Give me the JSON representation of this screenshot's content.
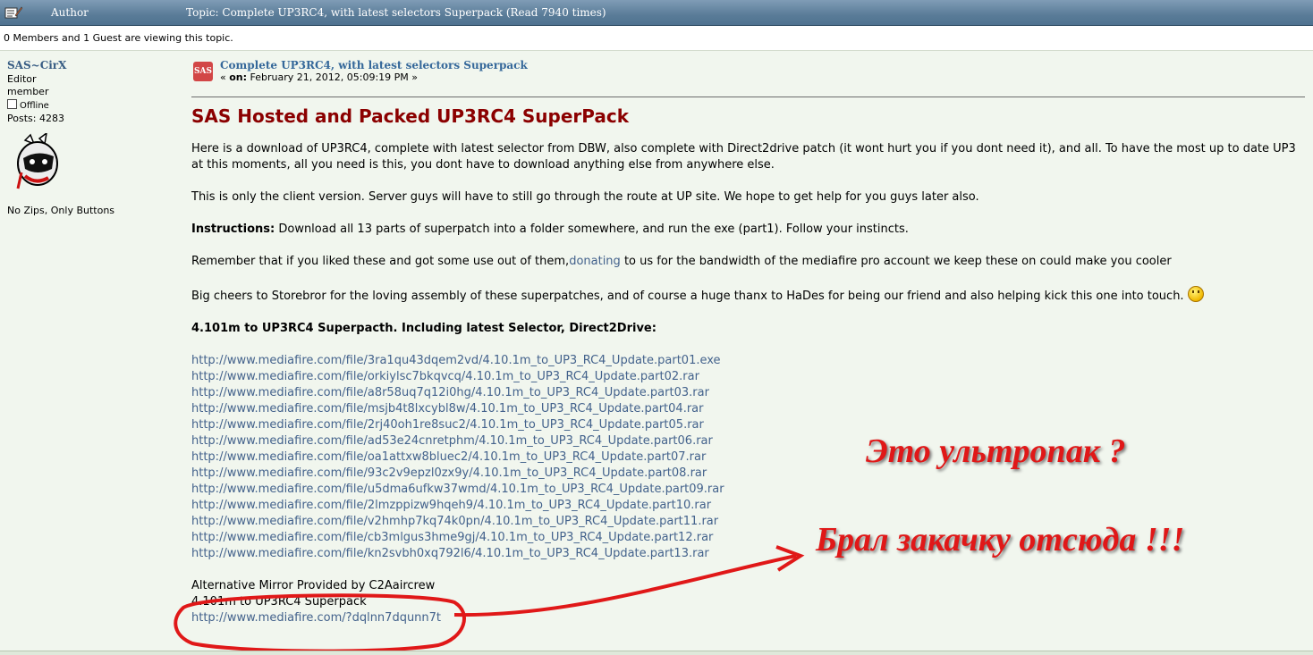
{
  "header": {
    "author_label": "Author",
    "topic_title": "Topic: Complete UP3RC4, with latest selectors Superpack  (Read 7940 times)"
  },
  "viewers_text": "0 Members and 1 Guest are viewing this topic.",
  "poster": {
    "name": "SAS~CirX",
    "title": "Editor",
    "group": "member",
    "status": "Offline",
    "posts": "Posts: 4283",
    "signature": "No Zips, Only Buttons"
  },
  "post": {
    "icon_text": "SAS",
    "subject": "Complete UP3RC4, with latest selectors Superpack",
    "on_prefix": "« ",
    "on_label": "on:",
    "date": " February 21, 2012, 05:09:19 PM »",
    "heading": "SAS Hosted and Packed UP3RC4 SuperPack",
    "para1": "Here is a download of UP3RC4, complete with latest selector from DBW, also complete with Direct2drive patch (it wont hurt you if you dont need it), and all. To have the most up to date UP3 at this moments, all you need is this, you dont have to download anything else from anywhere else.",
    "para2": "This is only the client version. Server guys will have to still go through the route at UP site. We hope to get help for you guys later also.",
    "instructions_label": "Instructions:",
    "instructions_text": " Download all 13 parts of superpatch into a folder somewhere, and run the exe (part1). Follow your instincts.",
    "remember_before": "Remember that if you liked these and got some use out of them,",
    "donating_link": "donating",
    "remember_after": " to us for the bandwidth of the mediafire pro account we keep these on could make you cooler",
    "cheers": "Big cheers to Storebror for the loving assembly of these superpatches, and of course a huge thanx to HaDes for being our friend and also helping kick this one into touch.",
    "superpatch_heading": "4.101m to UP3RC4 Superpacth. Including latest Selector, Direct2Drive:",
    "links": [
      "http://www.mediafire.com/file/3ra1qu43dqem2vd/4.10.1m_to_UP3_RC4_Update.part01.exe",
      "http://www.mediafire.com/file/orkiylsc7bkqvcq/4.10.1m_to_UP3_RC4_Update.part02.rar",
      "http://www.mediafire.com/file/a8r58uq7q12i0hg/4.10.1m_to_UP3_RC4_Update.part03.rar",
      "http://www.mediafire.com/file/msjb4t8lxcybl8w/4.10.1m_to_UP3_RC4_Update.part04.rar",
      "http://www.mediafire.com/file/2rj40oh1re8suc2/4.10.1m_to_UP3_RC4_Update.part05.rar",
      "http://www.mediafire.com/file/ad53e24cnretphm/4.10.1m_to_UP3_RC4_Update.part06.rar",
      "http://www.mediafire.com/file/oa1attxw8bluec2/4.10.1m_to_UP3_RC4_Update.part07.rar",
      "http://www.mediafire.com/file/93c2v9epzl0zx9y/4.10.1m_to_UP3_RC4_Update.part08.rar",
      "http://www.mediafire.com/file/u5dma6ufkw37wmd/4.10.1m_to_UP3_RC4_Update.part09.rar",
      "http://www.mediafire.com/file/2lmzppizw9hqeh9/4.10.1m_to_UP3_RC4_Update.part10.rar",
      "http://www.mediafire.com/file/v2hmhp7kq74k0pn/4.10.1m_to_UP3_RC4_Update.part11.rar",
      "http://www.mediafire.com/file/cb3mlgus3hme9gj/4.10.1m_to_UP3_RC4_Update.part12.rar",
      "http://www.mediafire.com/file/kn2svbh0xq792l6/4.10.1m_to_UP3_RC4_Update.part13.rar"
    ],
    "mirror_label": "Alternative Mirror Provided by C2Aaircrew",
    "mirror_title": "4.101m to UP3RC4 Superpack",
    "mirror_link": "http://www.mediafire.com/?dqlnn7dqunn7t"
  },
  "annotations": {
    "question": "Это ультропак ?",
    "took_from": "Брал закачку отсюда !!!",
    "color": "#e01818"
  }
}
